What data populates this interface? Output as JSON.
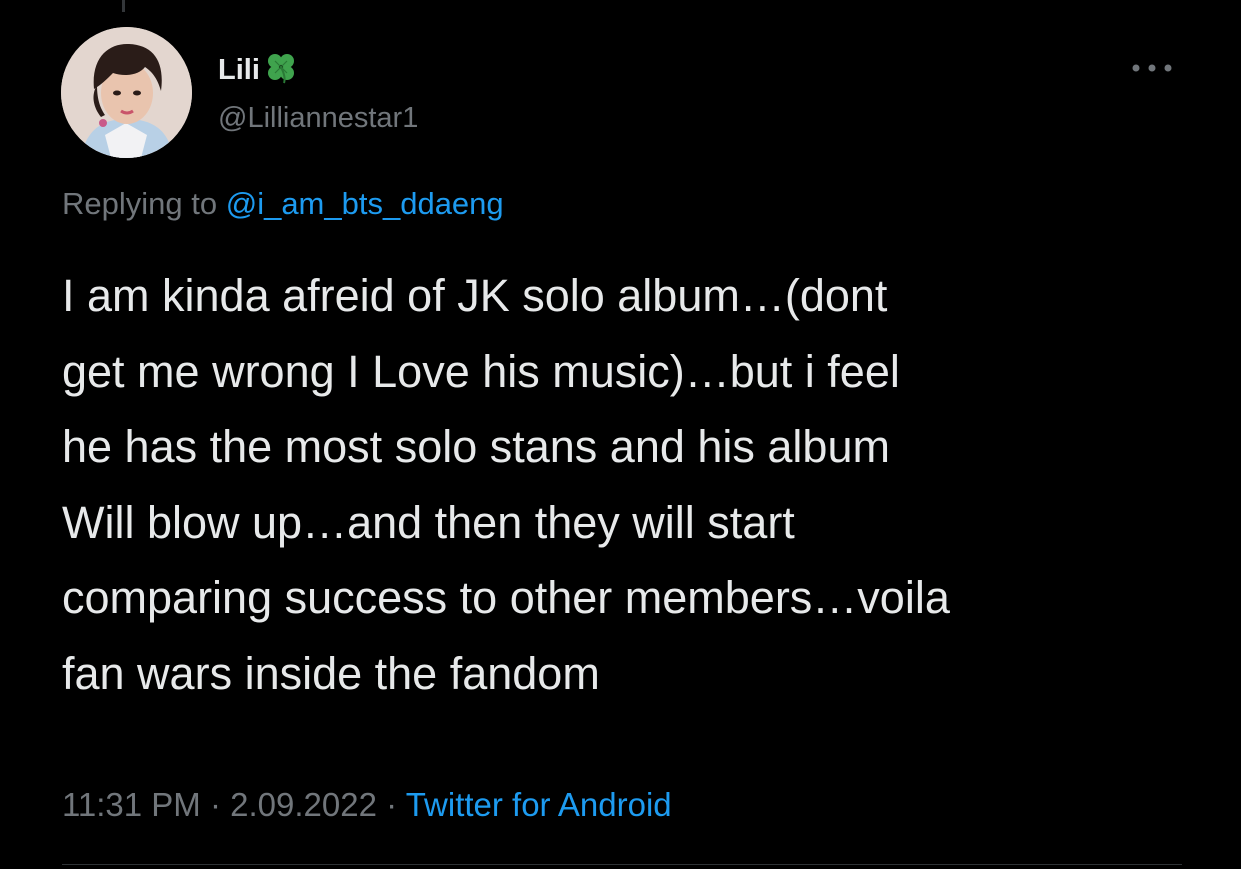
{
  "tweet": {
    "author": {
      "display_name": "Lili",
      "name_emoji": "four-leaf-clover-icon",
      "handle": "@Lilliannestar1"
    },
    "reply_prefix": "Replying to ",
    "reply_to": "@i_am_bts_ddaeng",
    "text_lines": [
      "I am kinda afreid of JK solo album…(dont",
      "get me wrong I Love his music)…but i feel",
      "he has the most solo stans and his album",
      "Will blow up…and then they will start",
      "comparing success to other members…voila",
      "fan wars inside the fandom"
    ],
    "time": "11:31 PM",
    "separator": " · ",
    "date": "2.09.2022",
    "source": "Twitter for Android"
  },
  "icons": {
    "more": "more-horizontal-icon",
    "clover": "four-leaf-clover-icon"
  },
  "colors": {
    "background": "#000000",
    "text_primary": "#e7e9ea",
    "text_secondary": "#71767b",
    "accent_link": "#1d9bf0",
    "clover_green": "#3fa34d",
    "divider": "#2f3336"
  }
}
